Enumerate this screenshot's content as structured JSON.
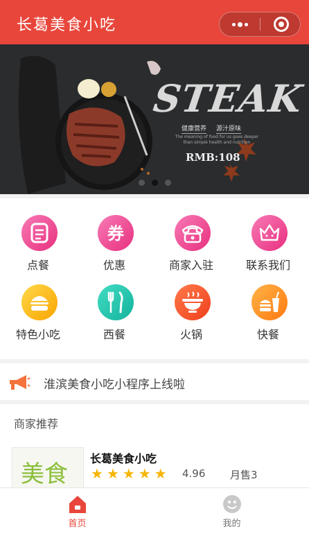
{
  "app": {
    "title": "长葛美食小吃"
  },
  "banner": {
    "headline": "STEAK",
    "tags": [
      "健康营养",
      "源汁原味"
    ],
    "description": "The meaning of food for us goes deeper than simple health and nutrition",
    "price": "RMB:108",
    "dots_total": 3,
    "dots_active": 2
  },
  "categories": [
    {
      "label": "点餐",
      "icon": "order-icon",
      "color": "#f0529a"
    },
    {
      "label": "优惠",
      "icon": "coupon-icon",
      "color": "#f0529a"
    },
    {
      "label": "商家入驻",
      "icon": "telephone-icon",
      "color": "#f0529a"
    },
    {
      "label": "联系我们",
      "icon": "contact-icon",
      "color": "#f0529a"
    },
    {
      "label": "特色小吃",
      "icon": "burger-icon",
      "color": "#fdb813"
    },
    {
      "label": "西餐",
      "icon": "fork-knife-icon",
      "color": "#1fc8b0"
    },
    {
      "label": "火锅",
      "icon": "hotpot-icon",
      "color": "#ff5a2c"
    },
    {
      "label": "快餐",
      "icon": "fastfood-icon",
      "color": "#ff8a1f"
    }
  ],
  "notice": {
    "text": "淮滨美食小吃小程序上线啦",
    "icon": "megaphone-icon"
  },
  "section": {
    "title": "商家推荐"
  },
  "shops": [
    {
      "name": "长葛美食小吃",
      "thumb_text": "美食",
      "stars": 5,
      "rating": "4.96",
      "sales": "月售3"
    }
  ],
  "tabbar": {
    "items": [
      {
        "label": "首页",
        "icon": "home-icon",
        "active": true
      },
      {
        "label": "我的",
        "icon": "user-icon",
        "active": false
      }
    ],
    "active_color": "#e8463b",
    "inactive_color": "#777777"
  },
  "colors": {
    "brand": "#e8463b"
  }
}
